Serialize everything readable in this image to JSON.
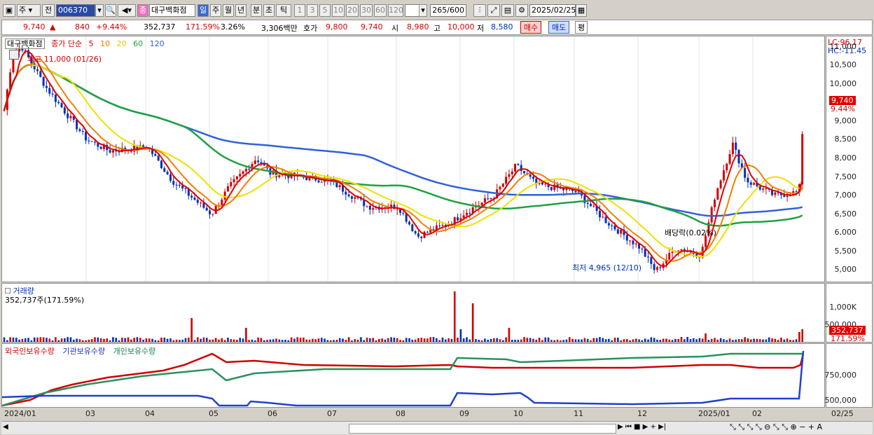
{
  "toolbar": {
    "type1": "주",
    "type2": "전",
    "code": "006370",
    "name": "대구백화점",
    "name_badge": "종",
    "periods": [
      "일",
      "주",
      "월",
      "년",
      "분",
      "초",
      "틱"
    ],
    "active_period": "일",
    "intervals": [
      "1",
      "3",
      "5",
      "10",
      "20",
      "30",
      "60",
      "120"
    ],
    "count": "265",
    "count_max": "/600",
    "date": "2025/02/25"
  },
  "info": {
    "price": "9,740",
    "change": "840",
    "pct": "+9.44%",
    "volume": "352,737",
    "vol_pct": "171.59%",
    "turnover": "3.26%",
    "amount": "3,306백만",
    "ask_label": "호가",
    "ask": "9,800",
    "ask2": "9,740",
    "open_label": "시",
    "open": "8,980",
    "high_label": "고",
    "high": "10,000",
    "low_label": "저",
    "low": "8,580",
    "buy": "매수",
    "sell": "매도",
    "avg": "평"
  },
  "price_panel": {
    "title": "대구백화점",
    "legend_label": "종가 단순",
    "ma": [
      "5",
      "10",
      "20",
      "60",
      "120"
    ],
    "ma_colors": [
      "#e00000",
      "#f08000",
      "#f0e000",
      "#20a040",
      "#3060e0"
    ],
    "high_note": "최고 11,000 (01/26)",
    "low_note": "최저 4,965 (12/10)",
    "dividend_note": "배당락(0.02%)",
    "lc": "LC:96.17",
    "hc": "HC:-11.45",
    "last_price": "9,740",
    "last_pct": "9.44%",
    "yticks": [
      "11,000",
      "10,500",
      "10,000",
      "9,500",
      "9,000",
      "8,500",
      "8,000",
      "7,500",
      "7,000",
      "6,500",
      "6,000",
      "5,500",
      "5,000"
    ]
  },
  "volume_panel": {
    "title": "거래량",
    "value": "352,737주(171.59%)",
    "yticks": [
      "1,000K",
      "500,000"
    ],
    "last": "352,737",
    "last_pct": "171.59%"
  },
  "holding_panel": {
    "labels": [
      "외국인보유수량",
      "기관보유수량",
      "개인보유수량"
    ],
    "yticks": [
      "750,000",
      "500,000"
    ]
  },
  "xaxis": {
    "labels": [
      "2024/01",
      "03",
      "04",
      "05",
      "06",
      "07",
      "08",
      "09",
      "10",
      "11",
      "12",
      "2025/01",
      "02",
      "02/25"
    ]
  },
  "chart_data": {
    "type": "line",
    "title": "대구백화점",
    "ylim": [
      4800,
      11200
    ],
    "x_range": [
      "2024/01",
      "2025/02/25"
    ],
    "close_approx": [
      {
        "x": "2024/01",
        "y": 9300
      },
      {
        "x": "2024/01/26",
        "y": 11000
      },
      {
        "x": "2024/02",
        "y": 9900
      },
      {
        "x": "2024/03",
        "y": 8500
      },
      {
        "x": "2024/04",
        "y": 8300
      },
      {
        "x": "2024/05",
        "y": 6600
      },
      {
        "x": "2024/05/20",
        "y": 7200
      },
      {
        "x": "2024/06",
        "y": 8000
      },
      {
        "x": "2024/07",
        "y": 7400
      },
      {
        "x": "2024/08",
        "y": 6700
      },
      {
        "x": "2024/08/20",
        "y": 5900
      },
      {
        "x": "2024/09",
        "y": 6500
      },
      {
        "x": "2024/10",
        "y": 7800
      },
      {
        "x": "2024/11",
        "y": 7000
      },
      {
        "x": "2024/12/10",
        "y": 4965
      },
      {
        "x": "2025/01",
        "y": 5700
      },
      {
        "x": "2025/01/15",
        "y": 8200
      },
      {
        "x": "2025/02",
        "y": 7100
      },
      {
        "x": "2025/02/25",
        "y": 9740
      }
    ]
  }
}
